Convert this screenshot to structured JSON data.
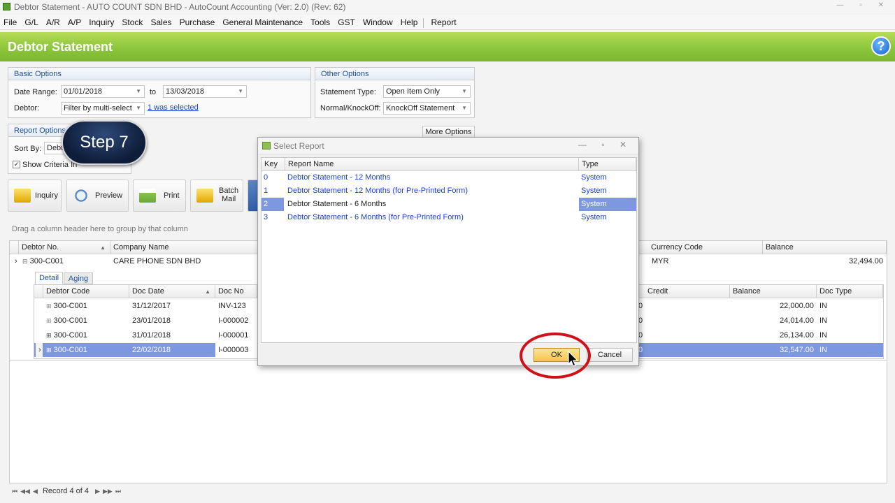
{
  "window": {
    "title": "Debtor Statement - AUTO COUNT SDN BHD - AutoCount Accounting (Ver: 2.0) (Rev: 62)"
  },
  "menu": [
    "File",
    "G/L",
    "A/R",
    "A/P",
    "Inquiry",
    "Stock",
    "Sales",
    "Purchase",
    "General Maintenance",
    "Tools",
    "GST",
    "Window",
    "Help",
    "Report"
  ],
  "header": {
    "title": "Debtor Statement",
    "help_icon": "?"
  },
  "basic_options": {
    "title": "Basic Options",
    "date_range_label": "Date Range:",
    "date_from": "01/01/2018",
    "to_label": "to",
    "date_to": "13/03/2018",
    "debtor_label": "Debtor:",
    "debtor_filter": "Filter by multi-select",
    "selected_link": "1 was selected"
  },
  "other_options": {
    "title": "Other Options",
    "statement_type_label": "Statement Type:",
    "statement_type": "Open Item Only",
    "knockoff_label": "Normal/KnockOff:",
    "knockoff": "KnockOff Statement"
  },
  "report_options": {
    "title": "Report Options",
    "sort_by_label": "Sort By:",
    "sort_by": "Debt",
    "show_criteria": "Show Criteria In",
    "more_options": "More Options"
  },
  "toolbar": {
    "inquiry": "Inquiry",
    "preview": "Preview",
    "print": "Print",
    "batch_mail": "Batch\nMail"
  },
  "overlay": {
    "step": "Step 7"
  },
  "grid": {
    "group_hint": "Drag a column header here to group by that column",
    "columns": [
      "Debtor No.",
      "Company Name",
      "Currency Code",
      "Balance"
    ],
    "master_row": {
      "debtor_no": "300-C001",
      "company": "CARE PHONE SDN BHD",
      "currency": "MYR",
      "balance": "32,494.00"
    },
    "tabs": [
      "Detail",
      "Aging"
    ],
    "detail_columns": [
      "Debtor Code",
      "Doc Date",
      "Doc No",
      "Credit",
      "Balance",
      "Doc Type"
    ],
    "detail_rows": [
      {
        "code": "300-C001",
        "date": "31/12/2017",
        "docno": "INV-123",
        "credit": "0",
        "balance": "22,000.00",
        "type": "IN"
      },
      {
        "code": "300-C001",
        "date": "23/01/2018",
        "docno": "I-000002",
        "credit": "0",
        "balance": "24,014.00",
        "type": "IN"
      },
      {
        "code": "300-C001",
        "date": "31/01/2018",
        "docno": "I-000001",
        "credit": "0",
        "balance": "26,134.00",
        "type": "IN"
      },
      {
        "code": "300-C001",
        "date": "22/02/2018",
        "docno": "I-000003",
        "credit": "0",
        "balance": "32,547.00",
        "type": "IN"
      }
    ],
    "record_nav": "Record 4 of 4"
  },
  "dialog": {
    "title": "Select Report",
    "columns": [
      "Key",
      "Report Name",
      "Type"
    ],
    "rows": [
      {
        "key": "0",
        "name": "Debtor Statement - 12 Months",
        "type": "System"
      },
      {
        "key": "1",
        "name": "Debtor Statement - 12 Months (for Pre-Printed Form)",
        "type": "System"
      },
      {
        "key": "2",
        "name": "Debtor Statement - 6 Months",
        "type": "System"
      },
      {
        "key": "3",
        "name": "Debtor Statement - 6 Months (for Pre-Printed Form)",
        "type": "System"
      }
    ],
    "ok": "OK",
    "cancel": "Cancel"
  },
  "colors": {
    "header_green": "#8cc63c",
    "selection": "#7d97e0",
    "ok_yellow": "#f4c64a",
    "highlight_red": "#d0101a"
  }
}
